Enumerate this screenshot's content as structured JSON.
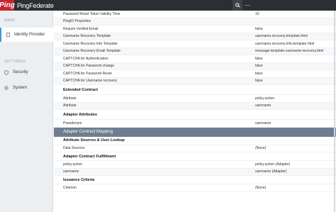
{
  "brand": {
    "logo": "Ping",
    "title": "PingFederate"
  },
  "topbar": {
    "search_icon": "search-icon",
    "more_icon": "more-icon"
  },
  "sidebar": {
    "main_label": "MAIN",
    "settings_label": "SETTINGS",
    "items": [
      {
        "label": "Identity Provider",
        "icon": "identity-icon",
        "active": true
      },
      {
        "label": "Security",
        "icon": "shield-icon"
      },
      {
        "label": "System",
        "icon": "gear-icon"
      }
    ]
  },
  "rows_a": [
    {
      "k": "Password Reset Token Validity Time",
      "v": "10"
    },
    {
      "k": "PingID Properties",
      "v": ""
    },
    {
      "k": "Require Verified Email",
      "v": "false"
    },
    {
      "k": "Username Recovery Template",
      "v": "username.recovery.template.html"
    },
    {
      "k": "Username Recovery Info Template",
      "v": "username.recovery.info.template.html"
    },
    {
      "k": "Username Recovery Email Template",
      "v": "message-template-username-recovery.html"
    },
    {
      "k": "CAPTCHA for Authentication",
      "v": "false"
    },
    {
      "k": "CAPTCHA for Password change",
      "v": "false"
    },
    {
      "k": "CAPTCHA for Password Reset",
      "v": "false"
    },
    {
      "k": "CAPTCHA for Username recovery",
      "v": "false"
    }
  ],
  "extended_contract": {
    "header": "Extended Contract",
    "rows": [
      {
        "k": "Attribute",
        "v": "policy.action"
      },
      {
        "k": "Attribute",
        "v": "username"
      }
    ]
  },
  "adapter_attributes": {
    "header": "Adapter Attributes",
    "rows": [
      {
        "k": "Pseudonym",
        "v": "username"
      }
    ]
  },
  "band": "Adapter Contract Mapping",
  "attribute_sources": {
    "header": "Attribute Sources & User Lookup",
    "rows": [
      {
        "k": "Data Sources",
        "v": "(None)"
      }
    ]
  },
  "contract_fulfillment": {
    "header": "Adapter Contract Fulfillment",
    "rows": [
      {
        "k": "policy.action",
        "v": "policy.action (Adapter)"
      },
      {
        "k": "username",
        "v": "username (Adapter)"
      }
    ]
  },
  "issuance_criteria": {
    "header": "Issuance Criteria",
    "rows": [
      {
        "k": "Criterion",
        "v": "(None)"
      }
    ]
  }
}
